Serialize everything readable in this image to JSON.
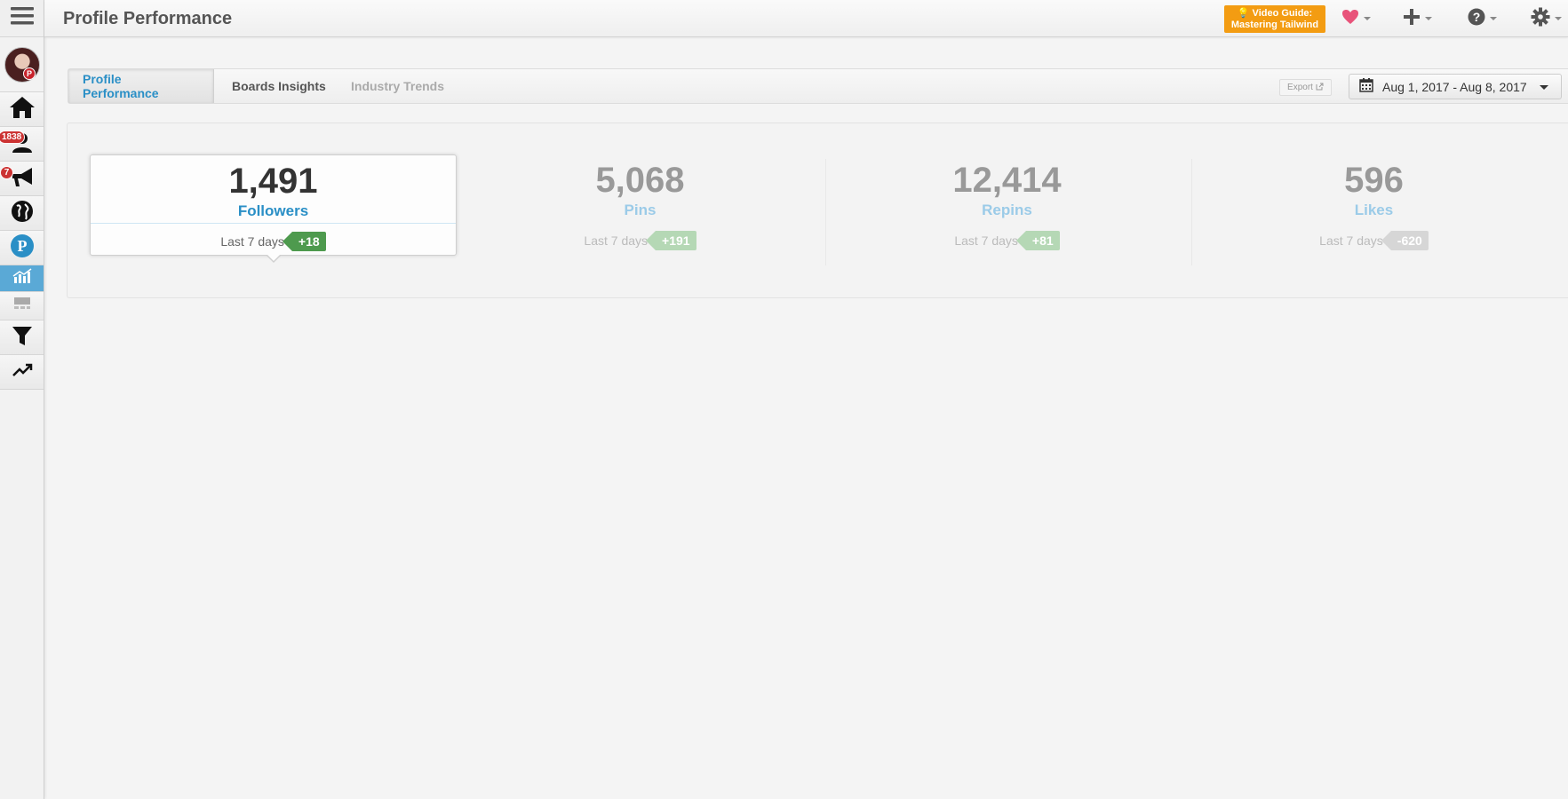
{
  "header": {
    "title": "Profile Performance",
    "video_guide_line1": "💡 Video Guide:",
    "video_guide_line2": "Mastering Tailwind"
  },
  "sidebar": {
    "badges": {
      "community": "1838",
      "campaigns": "7"
    },
    "avatar_pin_glyph": "P"
  },
  "tabs": [
    {
      "label": "Profile Performance",
      "state": "active"
    },
    {
      "label": "Boards Insights",
      "state": "normal"
    },
    {
      "label": "Industry Trends",
      "state": "disabled"
    }
  ],
  "export_label": "Export",
  "date_range": "Aug 1, 2017 - Aug 8, 2017",
  "stats": [
    {
      "value": "1,491",
      "label": "Followers",
      "period": "Last 7 days",
      "delta": "+18",
      "selected": true
    },
    {
      "value": "5,068",
      "label": "Pins",
      "period": "Last 7 days",
      "delta": "+191",
      "selected": false
    },
    {
      "value": "12,414",
      "label": "Repins",
      "period": "Last 7 days",
      "delta": "+81",
      "selected": false
    },
    {
      "value": "596",
      "label": "Likes",
      "period": "Last 7 days",
      "delta": "-620",
      "selected": false
    }
  ],
  "colors": {
    "accent_blue": "#2a8fc6",
    "delta_green": "#4e9a4e",
    "delta_green_dim": "#b5d8b5",
    "delta_gray_dim": "#d6d6d6",
    "video_guide_orange": "#f39c12",
    "heart_pink": "#e8537a"
  }
}
